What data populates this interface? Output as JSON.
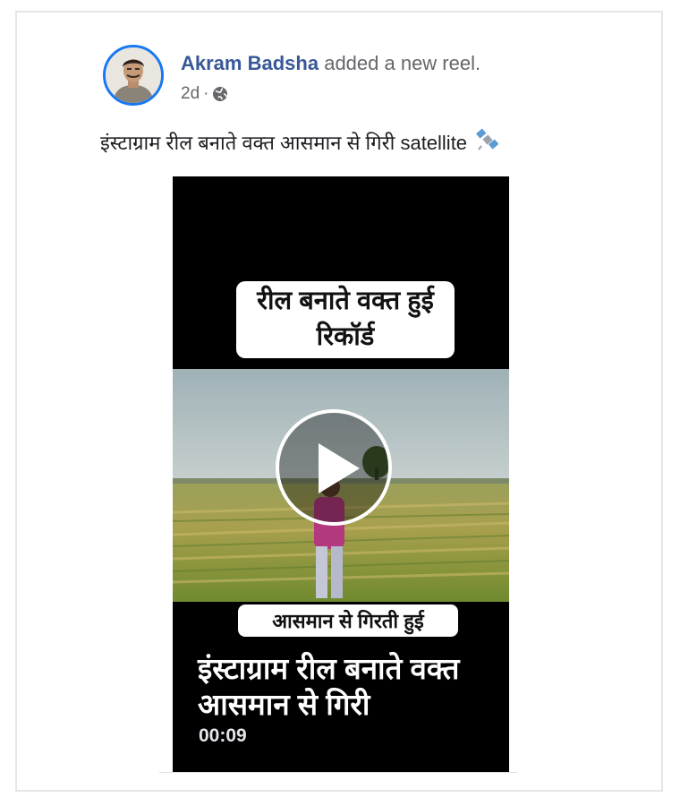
{
  "post": {
    "author_name": "Akram Badsha",
    "action_text": "added a new reel.",
    "timestamp": "2d",
    "separator": "·",
    "privacy_icon": "globe-icon",
    "caption": "इंस्टाग्राम रील बनाते वक्त आसमान से गिरी satellite",
    "caption_icon": "satellite-icon"
  },
  "video": {
    "top_label": "रील बनाते वक्त हुई रिकॉर्ड",
    "bottom_label": "आसमान से गिरती हुई",
    "overlay_title": "इंस्टाग्राम रील बनाते वक्त आसमान से गिरी",
    "duration": "00:09",
    "play_icon": "play-icon"
  },
  "colors": {
    "author_link": "#385898",
    "avatar_ring": "#1877f2",
    "secondary_text": "#65676b"
  }
}
